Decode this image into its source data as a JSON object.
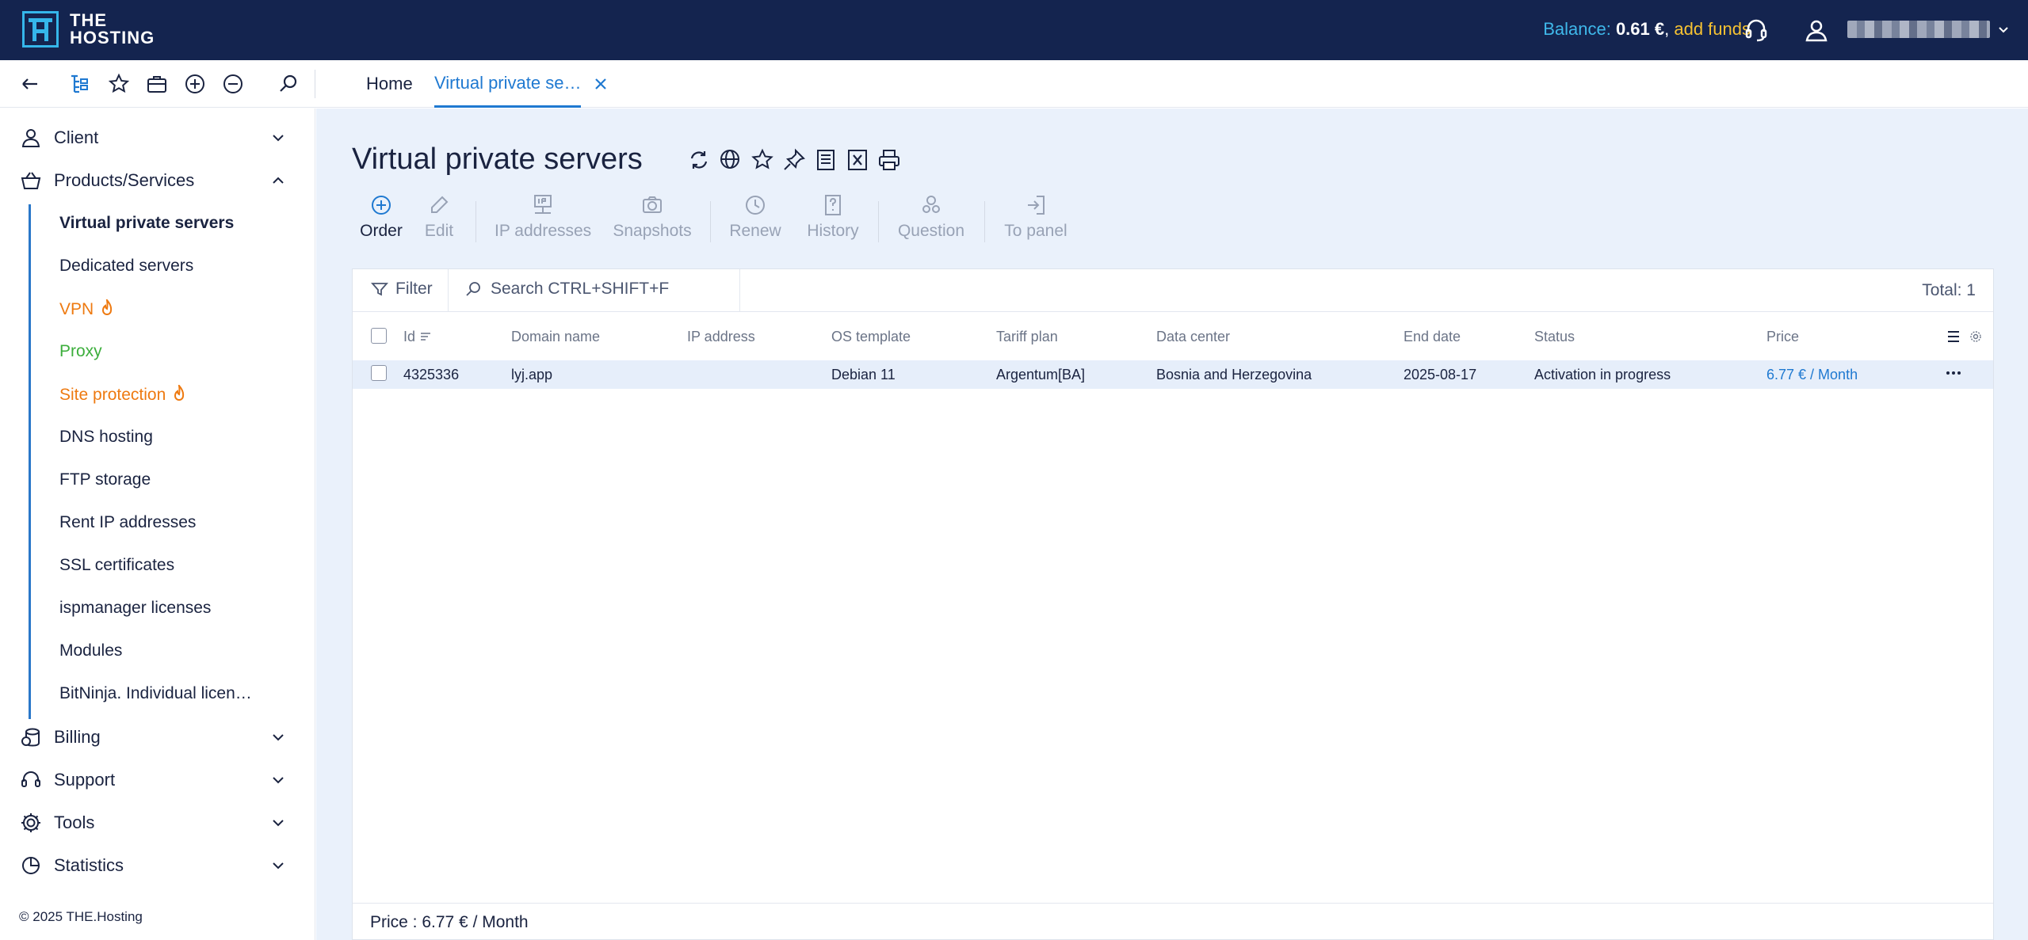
{
  "brand": {
    "name_line1": "THE",
    "name_line2": "HOSTING"
  },
  "header": {
    "balance_label": "Balance:",
    "balance_value": "0.61 €",
    "balance_separator": ",",
    "add_funds": "add funds",
    "colors": {
      "bg": "#14244f",
      "balance_label": "#3fb8ea",
      "add_funds": "#f6c232"
    }
  },
  "tabs": {
    "home": "Home",
    "vps": "Virtual private se…"
  },
  "sidebar": {
    "groups": [
      {
        "label": "Client"
      },
      {
        "label": "Products/Services"
      },
      {
        "label": "Billing"
      },
      {
        "label": "Support"
      },
      {
        "label": "Tools"
      },
      {
        "label": "Statistics"
      }
    ],
    "items": [
      {
        "label": "Virtual private servers"
      },
      {
        "label": "Dedicated servers"
      },
      {
        "label": "VPN"
      },
      {
        "label": "Proxy"
      },
      {
        "label": "Site protection"
      },
      {
        "label": "DNS hosting"
      },
      {
        "label": "FTP storage"
      },
      {
        "label": "Rent IP addresses"
      },
      {
        "label": "SSL certificates"
      },
      {
        "label": "ispmanager licenses"
      },
      {
        "label": "Modules"
      },
      {
        "label": "BitNinja. Individual licen…"
      }
    ],
    "copyright": "© 2025 THE.Hosting"
  },
  "page": {
    "title": "Virtual private servers",
    "actions": [
      {
        "label": "Order",
        "icon": "plus-circle-icon"
      },
      {
        "label": "Edit",
        "icon": "pencil-icon"
      },
      {
        "label": "IP addresses",
        "icon": "ip-icon"
      },
      {
        "label": "Snapshots",
        "icon": "camera-icon"
      },
      {
        "label": "Renew",
        "icon": "clock-icon"
      },
      {
        "label": "History",
        "icon": "question-icon"
      },
      {
        "label": "Question",
        "icon": "users-icon"
      },
      {
        "label": "To panel",
        "icon": "login-icon"
      }
    ],
    "filter_label": "Filter",
    "search_placeholder": "Search CTRL+SHIFT+F",
    "total": "Total: 1",
    "columns": [
      "Id",
      "Domain name",
      "IP address",
      "OS template",
      "Tariff plan",
      "Data center",
      "End date",
      "Status",
      "Price"
    ],
    "rows": [
      {
        "id": "4325336",
        "domain": "lyj.app",
        "ip": "",
        "os": "Debian 11",
        "tariff": "Argentum[BA]",
        "datacenter": "Bosnia and Herzegovina",
        "end_date": "2025-08-17",
        "status": "Activation in progress",
        "price": "6.77 € / Month"
      }
    ],
    "footer_price": "Price : 6.77 € / Month"
  }
}
